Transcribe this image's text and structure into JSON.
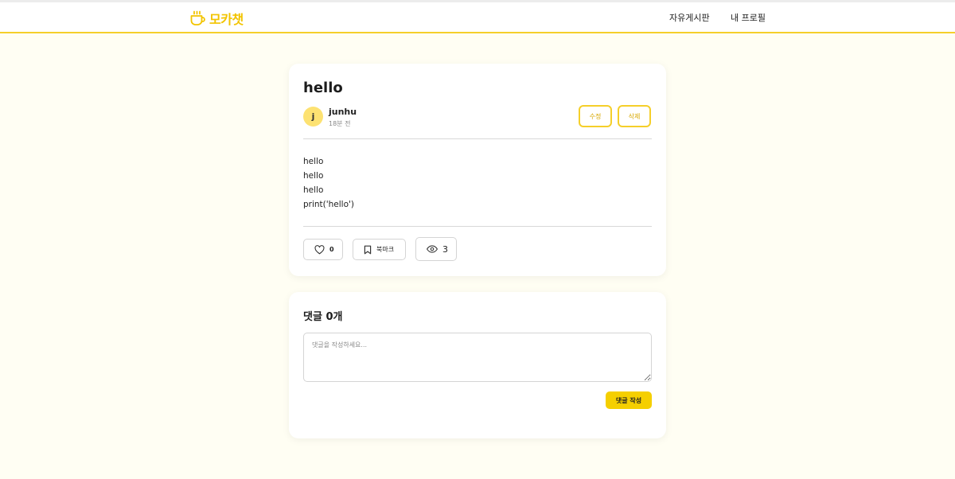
{
  "header": {
    "logo_text": "모카챗",
    "logo_icon": "coffee-cup-icon",
    "nav": [
      {
        "label": "자유게시판"
      },
      {
        "label": "내 프로필"
      }
    ]
  },
  "post": {
    "title": "hello",
    "author_initial": "j",
    "author": "junhu",
    "time": "18분 전",
    "edit_label": "수정",
    "delete_label": "삭제",
    "body_lines": [
      "hello",
      "hello",
      "hello",
      "print('hello')"
    ],
    "like_count": "0",
    "bookmark_label": "북마크",
    "view_count": "3"
  },
  "comments": {
    "title": "댓글 0개",
    "placeholder": "댓글을 작성하세요...",
    "value": "",
    "submit_label": "댓글 작성"
  },
  "colors": {
    "accent": "#f5cf2a",
    "background": "#fffef3",
    "avatar": "#fde272"
  }
}
